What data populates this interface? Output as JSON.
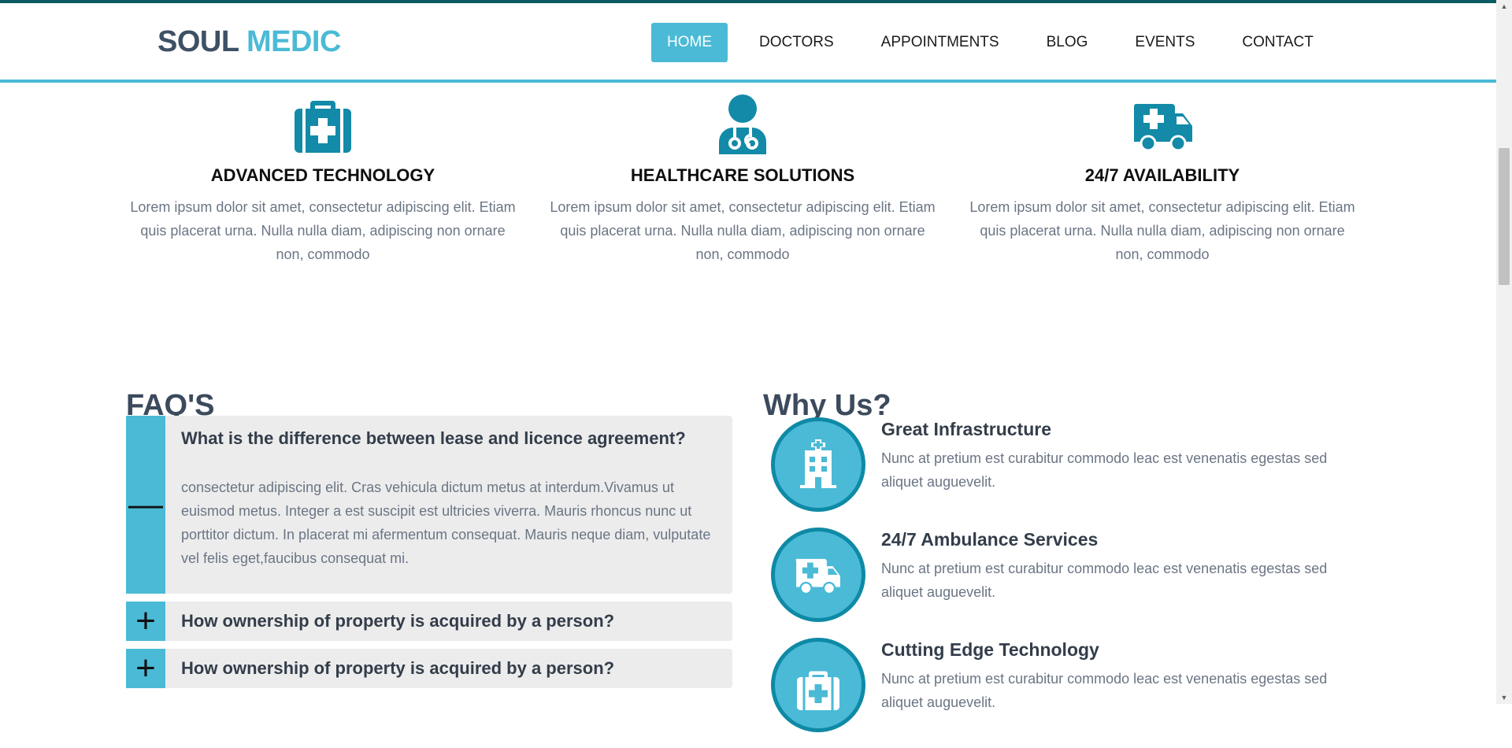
{
  "header": {
    "logo_part1": "SOUL",
    "logo_part2": "MEDIC",
    "nav": [
      {
        "label": "HOME"
      },
      {
        "label": "DOCTORS"
      },
      {
        "label": "APPOINTMENTS"
      },
      {
        "label": "BLOG"
      },
      {
        "label": "EVENTS"
      },
      {
        "label": "CONTACT"
      }
    ]
  },
  "features": [
    {
      "icon": "medical-kit-icon",
      "title": "ADVANCED TECHNOLOGY",
      "text": "Lorem ipsum dolor sit amet, consectetur adipiscing elit. Etiam quis placerat urna. Nulla nulla diam, adipiscing non ornare non, commodo"
    },
    {
      "icon": "doctor-icon",
      "title": "HEALTHCARE SOLUTIONS",
      "text": "Lorem ipsum dolor sit amet, consectetur adipiscing elit. Etiam quis placerat urna. Nulla nulla diam, adipiscing non ornare non, commodo"
    },
    {
      "icon": "ambulance-icon",
      "title": "24/7 AVAILABILITY",
      "text": "Lorem ipsum dolor sit amet, consectetur adipiscing elit. Etiam quis placerat urna. Nulla nulla diam, adipiscing non ornare non, commodo"
    }
  ],
  "faq": {
    "title": "FAQ'S",
    "items": [
      {
        "question": "What is the difference between lease and licence agreement?",
        "answer": "consectetur adipiscing elit. Cras vehicula dictum metus at interdum.Vivamus ut euismod metus. Integer a est suscipit est ultricies viverra. Mauris rhoncus nunc ut porttitor dictum. In placerat mi afermentum consequat. Mauris neque diam, vulputate vel felis eget,faucibus consequat mi.",
        "toggle": "—"
      },
      {
        "question": "How ownership of property is acquired by a person?",
        "toggle": "+"
      },
      {
        "question": "How ownership of property is acquired by a person?",
        "toggle": "+"
      }
    ]
  },
  "why": {
    "title": "Why Us?",
    "items": [
      {
        "icon": "hospital-icon",
        "title": "Great Infrastructure",
        "text": "Nunc at pretium est curabitur commodo leac est venenatis egestas sed aliquet auguevelit."
      },
      {
        "icon": "ambulance-icon",
        "title": "24/7 Ambulance Services",
        "text": "Nunc at pretium est curabitur commodo leac est venenatis egestas sed aliquet auguevelit."
      },
      {
        "icon": "medical-kit-icon",
        "title": "Cutting Edge Technology",
        "text": "Nunc at pretium est curabitur commodo leac est venenatis egestas sed aliquet auguevelit."
      }
    ]
  },
  "colors": {
    "accent": "#4bbad6",
    "accent_dark": "#0e8aa6",
    "icon": "#128aa8",
    "heading": "#3b4a5c"
  }
}
